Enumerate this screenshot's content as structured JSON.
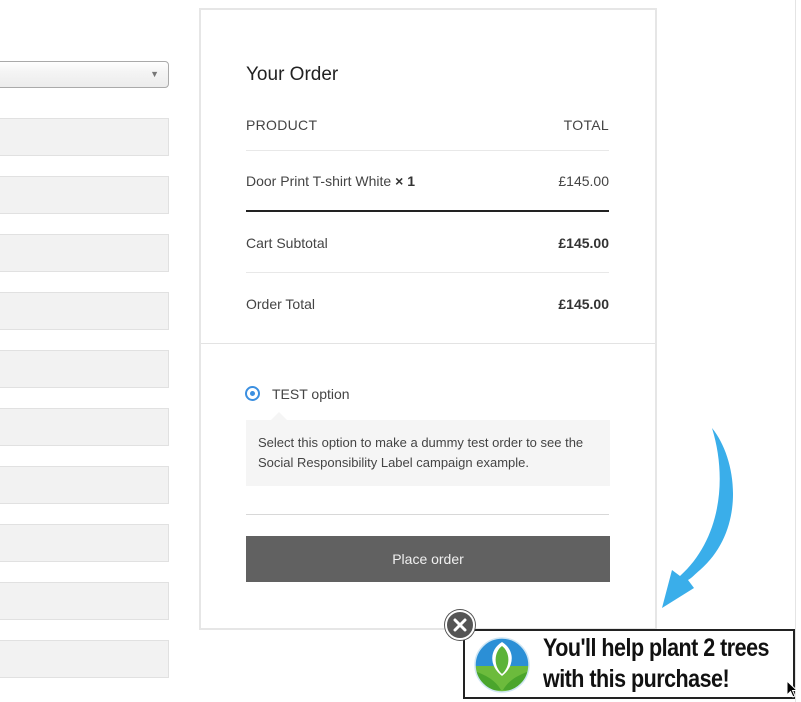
{
  "form": {
    "select_arrow": "▼"
  },
  "order": {
    "title": "Your Order",
    "header": {
      "product": "PRODUCT",
      "total": "TOTAL"
    },
    "item": {
      "name": "Door Print T-shirt White",
      "qty": "× 1",
      "price": "£145.00"
    },
    "subtotal": {
      "label": "Cart Subtotal",
      "value": "£145.00"
    },
    "total": {
      "label": "Order Total",
      "value": "£145.00"
    }
  },
  "payment": {
    "option_label": "TEST option",
    "description": "Select this option to make a dummy test order to see the Social Responsibility Label campaign example."
  },
  "actions": {
    "place_order": "Place order"
  },
  "popup": {
    "line1": "You'll help plant 2 trees",
    "line2": "with this purchase!",
    "logo_icon": "leaf-globe-icon",
    "close_icon": "close-icon"
  },
  "colors": {
    "accent_radio": "#3b8fe0",
    "button_bg": "#616161",
    "arrow": "#3aaeea",
    "logo_blue": "#2b8fd6",
    "logo_green": "#6cbb3c"
  }
}
